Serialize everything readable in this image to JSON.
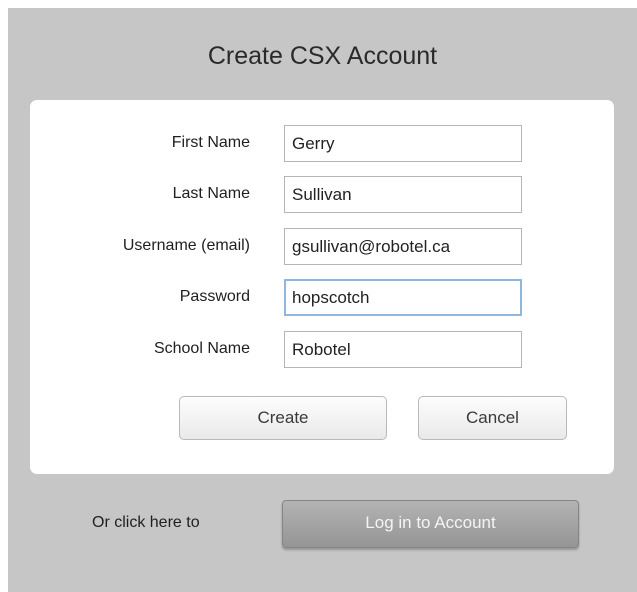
{
  "dialog": {
    "title": "Create CSX Account"
  },
  "form": {
    "fields": [
      {
        "label": "First Name",
        "value": "Gerry"
      },
      {
        "label": "Last Name",
        "value": "Sullivan"
      },
      {
        "label": "Username (email)",
        "value": "gsullivan@robotel.ca"
      },
      {
        "label": "Password",
        "value": "hopscotch",
        "focused": true
      },
      {
        "label": "School Name",
        "value": "Robotel"
      }
    ],
    "create_label": "Create",
    "cancel_label": "Cancel"
  },
  "footer": {
    "prompt": "Or click here to",
    "login_label": "Log in to Account"
  },
  "colors": {
    "dialog_background": "#c6c6c6",
    "card_background": "#ffffff",
    "focus_border": "#8fb7e0",
    "login_button": "#a3a3a3"
  }
}
